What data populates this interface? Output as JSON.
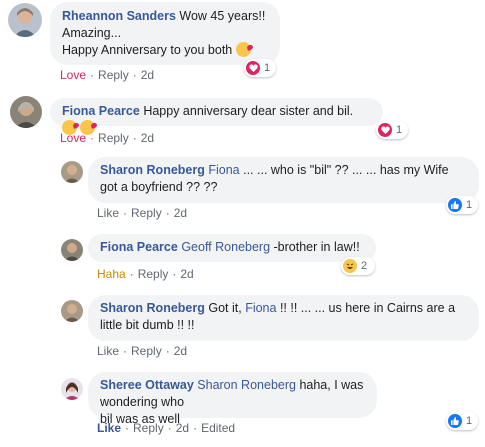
{
  "comments": [
    {
      "author": "Rheannon Sanders",
      "line1": "Wow 45 years!!",
      "line2": "Amazing...",
      "line3": "Happy Anniversary to you both",
      "reaction_label": "Love",
      "reply": "Reply",
      "time": "2d",
      "reaction_count": "1",
      "reaction_icon": "heart-icon"
    },
    {
      "author": "Fiona Pearce",
      "text": "Happy anniversary dear sister and bil.",
      "reaction_label": "Love",
      "reply": "Reply",
      "time": "2d",
      "reaction_count": "1",
      "reaction_icon": "heart-icon"
    }
  ],
  "replies": [
    {
      "author": "Sharon Roneberg",
      "mention": "Fiona",
      "line1": " ... ... who is \"bil\" ?? ... ... has my Wife",
      "line2": "got a boyfriend ?? ??",
      "reaction_label": "Like",
      "reply": "Reply",
      "time": "2d",
      "reaction_count": "1",
      "reaction_icon": "thumbs-up-icon"
    },
    {
      "author": "Fiona Pearce",
      "mention": "Geoff Roneberg",
      "text": " -brother in law!!",
      "reaction_label": "Haha",
      "reply": "Reply",
      "time": "2d",
      "reaction_count": "2",
      "reaction_icon": "laughing-face-icon"
    },
    {
      "author": "Sharon Roneberg",
      "pre": "Got it, ",
      "mention": "Fiona",
      "line1": " !! !! ... ... us here in Cairns are a",
      "line2": "little bit dumb !! !!",
      "reaction_label": "Like",
      "reply": "Reply",
      "time": "2d"
    },
    {
      "author": "Sheree Ottaway",
      "mention": "Sharon Roneberg",
      "line1": " haha, I was wondering who",
      "line2": "bil was as well",
      "reaction_label": "Like",
      "reply": "Reply",
      "time": "2d",
      "edited": "Edited",
      "reaction_count": "1",
      "reaction_icon": "thumbs-up-icon"
    }
  ],
  "colors": {
    "author_blue": "#385898",
    "bubble_gray": "#f2f3f5",
    "love_red": "#e0245e",
    "haha_yellow": "#c28d00",
    "like_blue": "#1877f2"
  }
}
